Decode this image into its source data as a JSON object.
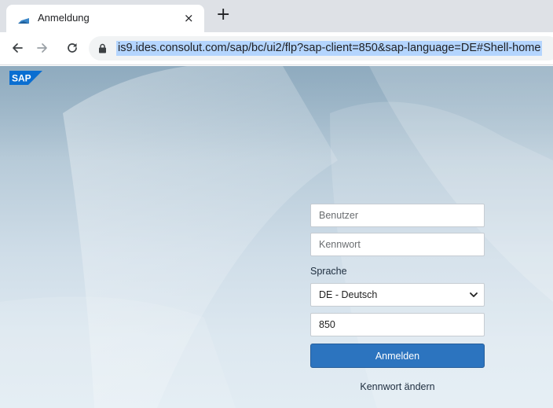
{
  "browser": {
    "tab": {
      "title": "Anmeldung",
      "close_glyph": "×",
      "favicon": "sap-favicon"
    },
    "new_tab_glyph": "+",
    "nav": {
      "back_icon": "arrow-left-icon",
      "forward_icon": "arrow-right-icon",
      "reload_icon": "reload-icon"
    },
    "address": {
      "url": "is9.ides.consolut.com/sap/bc/ui2/flp?sap-client=850&sap-language=DE#Shell-home",
      "lock_icon": "lock-icon"
    }
  },
  "page": {
    "logo_text": "SAP",
    "login": {
      "user_placeholder": "Benutzer",
      "password_placeholder": "Kennwort",
      "language_label": "Sprache",
      "language_value": "DE - Deutsch",
      "client_value": "850",
      "login_button": "Anmelden",
      "change_password_link": "Kennwort ändern"
    }
  },
  "colors": {
    "primary_button": "#2c74bf",
    "sap_logo": "#0a6ed1"
  }
}
